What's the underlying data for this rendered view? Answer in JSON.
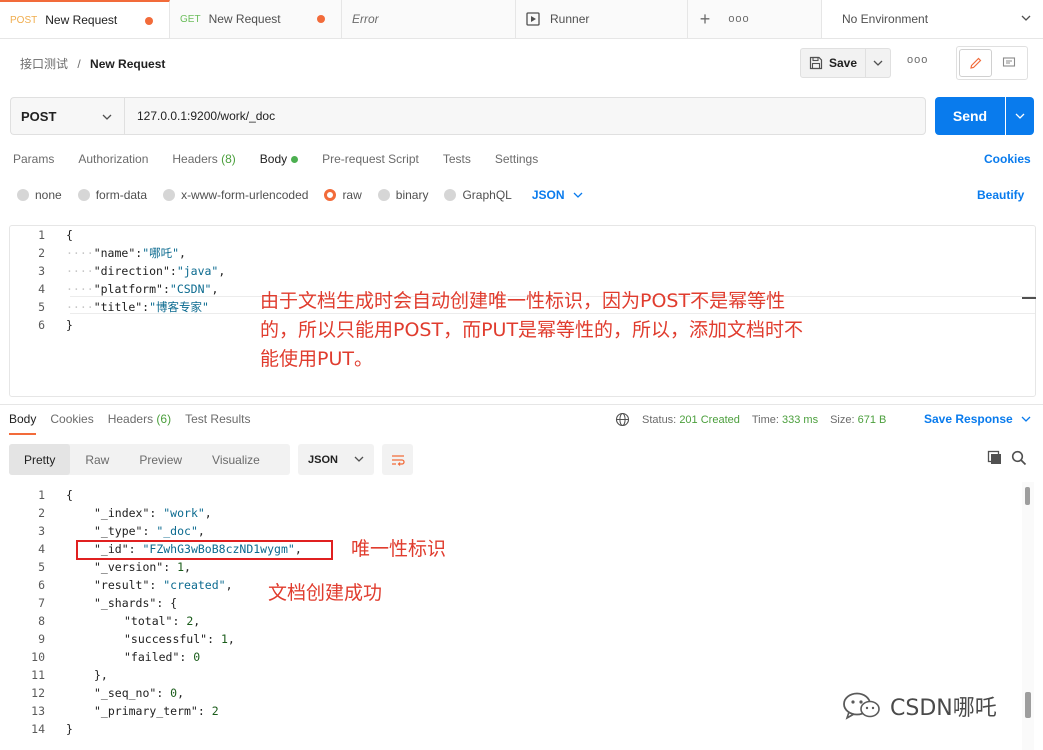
{
  "tabs": [
    {
      "method": "POST",
      "label": "New Request"
    },
    {
      "method": "GET",
      "label": "New Request"
    },
    {
      "label": "Error"
    },
    {
      "label": "Runner"
    }
  ],
  "tab_more": "ooo",
  "environment": "No Environment",
  "breadcrumb": {
    "collection": "接口测试",
    "separator": "/",
    "request": "New Request"
  },
  "toolbar": {
    "save_label": "Save",
    "more": "ooo"
  },
  "request": {
    "method": "POST",
    "url": "127.0.0.1:9200/work/_doc",
    "send_label": "Send",
    "tabs": {
      "params": "Params",
      "authorization": "Authorization",
      "headers": "Headers",
      "headers_count": "(8)",
      "body": "Body",
      "prescript": "Pre-request Script",
      "tests": "Tests",
      "settings": "Settings"
    },
    "cookies": "Cookies",
    "body_types": [
      "none",
      "form-data",
      "x-www-form-urlencoded",
      "raw",
      "binary",
      "GraphQL"
    ],
    "body_format": "JSON",
    "beautify": "Beautify",
    "body_lines": [
      "1",
      "2",
      "3",
      "4",
      "5",
      "6"
    ],
    "body_json": {
      "open": "{",
      "name_k": "\"name\"",
      "name_v": "\"哪吒\"",
      "direction_k": "\"direction\"",
      "direction_v": "\"java\"",
      "platform_k": "\"platform\"",
      "platform_v": "\"CSDN\"",
      "title_k": "\"title\"",
      "title_v": "\"博客专家\"",
      "close": "}"
    }
  },
  "annotations": {
    "note1_line1": "由于文档生成时会自动创建唯一性标识，因为POST不是幂等性",
    "note1_line2": "的，所以只能用POST，而PUT是幂等性的，所以，添加文档时不",
    "note1_line3": "能使用PUT。",
    "note2": "唯一性标识",
    "note3": "文档创建成功"
  },
  "response": {
    "tabs": {
      "body": "Body",
      "cookies": "Cookies",
      "headers": "Headers",
      "headers_count": "(6)",
      "tests": "Test Results"
    },
    "status_label": "Status:",
    "status_value": "201 Created",
    "time_label": "Time:",
    "time_value": "333 ms",
    "size_label": "Size:",
    "size_value": "671 B",
    "save_response": "Save Response",
    "views": [
      "Pretty",
      "Raw",
      "Preview",
      "Visualize"
    ],
    "format": "JSON",
    "lines": [
      "1",
      "2",
      "3",
      "4",
      "5",
      "6",
      "7",
      "8",
      "9",
      "10",
      "11",
      "12",
      "13",
      "14"
    ],
    "json": {
      "open": "{",
      "index_k": "\"_index\"",
      "index_v": "\"work\"",
      "type_k": "\"_type\"",
      "type_v": "\"_doc\"",
      "id_k": "\"_id\"",
      "id_v": "\"FZwhG3wBoB8czND1wygm\"",
      "version_k": "\"_version\"",
      "version_v": "1",
      "result_k": "\"result\"",
      "result_v": "\"created\"",
      "shards_k": "\"_shards\"",
      "shards_open": "{",
      "total_k": "\"total\"",
      "total_v": "2",
      "successful_k": "\"successful\"",
      "successful_v": "1",
      "failed_k": "\"failed\"",
      "failed_v": "0",
      "shards_close": "},",
      "seq_k": "\"_seq_no\"",
      "seq_v": "0",
      "term_k": "\"_primary_term\"",
      "term_v": "2",
      "close": "}"
    }
  },
  "watermark": "CSDN哪吒",
  "colors": {
    "accent": "#f26b3a",
    "primary": "#097bed",
    "success": "#4b9f3c",
    "annotation": "#e03c2e"
  }
}
